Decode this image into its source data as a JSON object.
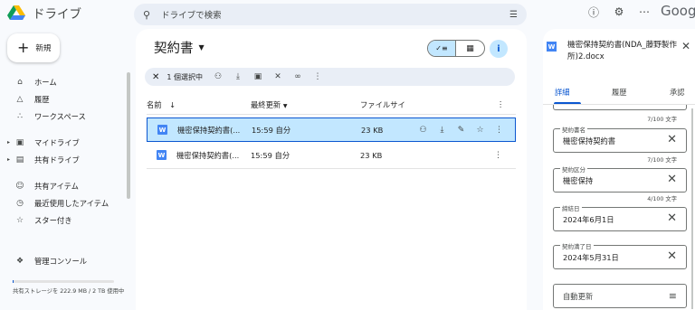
{
  "app": {
    "logo_text": "ドライブ",
    "brand": "Goog"
  },
  "search": {
    "placeholder": "ドライブで検索"
  },
  "sidebar": {
    "new_label": "新規",
    "items": [
      {
        "label": "ホーム",
        "icon": "home-icon"
      },
      {
        "label": "履歴",
        "icon": "bell-icon"
      },
      {
        "label": "ワークスペース",
        "icon": "workspaces-icon"
      },
      {
        "label": "マイドライブ",
        "icon": "my-drive-icon"
      },
      {
        "label": "共有ドライブ",
        "icon": "shared-drive-icon"
      },
      {
        "label": "共有アイテム",
        "icon": "people-icon"
      },
      {
        "label": "最近使用したアイテム",
        "icon": "clock-icon"
      },
      {
        "label": "スター付き",
        "icon": "star-icon"
      },
      {
        "label": "管理コンソール",
        "icon": "admin-icon"
      }
    ],
    "storage_text": "共有ストレージを 222.9 MB / 2 TB 使用中",
    "storage_fraction": 0.0001
  },
  "main": {
    "folder_title": "契約書",
    "selection": {
      "count_label": "1 個選択中"
    },
    "columns": {
      "name": "名前",
      "modified": "最終更新",
      "size": "ファイルサイ"
    },
    "rows": [
      {
        "name": "機密保持契約書(...",
        "modified": "15:59 自分",
        "size": "23 KB",
        "selected": true
      },
      {
        "name": "機密保持契約書(...",
        "modified": "15:59 自分",
        "size": "23 KB",
        "selected": false
      }
    ]
  },
  "details": {
    "file_title": "機密保持契約書(NDA_藤野製作所)2.docx",
    "tabs": [
      "詳細",
      "履歴",
      "承認"
    ],
    "top_counter": "7/100 文字",
    "fields": [
      {
        "label": "契約書名",
        "value": "機密保持契約書",
        "counter": "7/100 文字"
      },
      {
        "label": "契約区分",
        "value": "機密保持",
        "counter": "4/100 文字"
      },
      {
        "label": "締結日",
        "value": "2024年6月1日"
      },
      {
        "label": "契約満了日",
        "value": "2024年5月31日"
      }
    ],
    "auto_renew_label": "自動更新"
  }
}
